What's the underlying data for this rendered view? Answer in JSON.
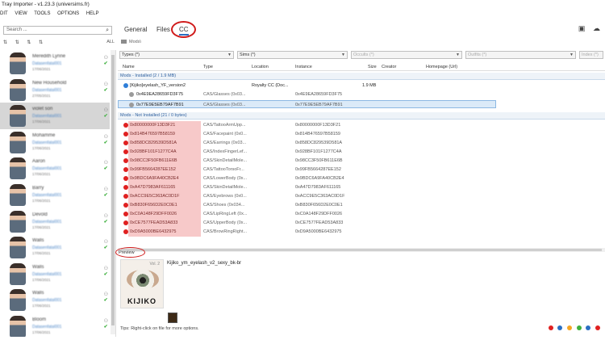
{
  "window": {
    "title": "Tray Importer - v1.23.3  (universims.fr)"
  },
  "menu": [
    "DIT",
    "VIEW",
    "TOOLS",
    "OPTIONS",
    "HELP"
  ],
  "search": {
    "placeholder": "Search ..."
  },
  "sidebar": {
    "tool_icons": [
      "sims-sort-icon",
      "households-sort-icon",
      "lots-sort-icon",
      "rooms-sort-icon"
    ],
    "all_label": "ALL",
    "households": [
      {
        "name": "Meredith Lynne",
        "sub": "Datasenfatal001",
        "date": "17/06/2021"
      },
      {
        "name": "New Household",
        "sub": "Datasenfatal001",
        "date": "27/05/2021"
      },
      {
        "name": "violet son",
        "sub": "Datasenfatal001",
        "date": "17/06/2021"
      },
      {
        "name": "Mohamme",
        "sub": "Datasenfatal001",
        "date": "17/06/2021"
      },
      {
        "name": "Aaron",
        "sub": "Datasenfatal001",
        "date": "17/06/2021"
      },
      {
        "name": "Barry",
        "sub": "Datasenfatal001",
        "date": "17/06/2021"
      },
      {
        "name": "Devold",
        "sub": "Datasenfatal001",
        "date": "17/06/2021"
      },
      {
        "name": "Walls",
        "sub": "Datasenfatal001",
        "date": "17/06/2021"
      },
      {
        "name": "Walls",
        "sub": "Datasenfatal001",
        "date": "17/06/2021"
      },
      {
        "name": "Walls",
        "sub": "Datasenfatal001",
        "date": "17/06/2021"
      },
      {
        "name": "Bloom",
        "sub": "Datasenfatal001",
        "date": "17/06/2021"
      }
    ]
  },
  "tabs": [
    {
      "label": "General"
    },
    {
      "label": "Files"
    },
    {
      "label": "CC"
    }
  ],
  "breadcrumb": "Mods\\",
  "filters": {
    "types": "Types (*)",
    "sims": "Sims (*)",
    "occults": "Occults (*)",
    "outfits": "Outfits (*)",
    "index": "Index (*)"
  },
  "columns": {
    "name": "Name",
    "type": "Type",
    "location": "Location",
    "instance": "Instance",
    "size": "Size",
    "creator": "Creator",
    "homepage": "Homepage (Url)"
  },
  "installed_group": "Mods - Installed  (2 / 1.9 MB)",
  "installed_rows": [
    {
      "name": "[Kijiko]eyelash_YF_version2",
      "type": "",
      "location": "Royalty CC (Doc...",
      "instance": "",
      "size": "1.9 MB",
      "dot": "#2f7ed8"
    },
    {
      "name": "0x4E9EA28659FD3F75",
      "type": "CAS/Glasses (0x03...",
      "location": "",
      "instance": "0x4E9EA28659FD3F75",
      "size": "",
      "dot": "#9a9a9a"
    },
    {
      "name": "0x77E9E5EB79AF7B91",
      "type": "CAS/Glasses (0x03...",
      "location": "",
      "instance": "0x77E9E5EB79AF7B91",
      "size": "",
      "dot": "#9a9a9a"
    }
  ],
  "notinstalled_group": "Mods - Not Installed  (21 / 0 bytes)",
  "notinstalled_rows": [
    {
      "name": "0x80000000F13D3F21",
      "type": "CAS/TattooArmUpp...",
      "instance": "0x80000000F13D3F21"
    },
    {
      "name": "0x814B476597B58159",
      "type": "CAS/Facepaint (0x0...",
      "instance": "0x814B476597B58159"
    },
    {
      "name": "0x858DC829539D581A",
      "type": "CAS/Earrings (0x03...",
      "instance": "0x858DC829539D581A"
    },
    {
      "name": "0x928BF101F1277C4A",
      "type": "CAS/IndexFingerLef...",
      "instance": "0x928BF101F1277C4A"
    },
    {
      "name": "0x98CC3F50FB611E6B",
      "type": "CAS/SkinDetailMole...",
      "instance": "0x98CC3F50FB611E6B"
    },
    {
      "name": "0x99FB5664287EE152",
      "type": "CAS/TattooTorsoFr...",
      "instance": "0x99FB5664287EE152"
    },
    {
      "name": "0x9BDC6A9FA40CB2E4",
      "type": "CAS/LowerBody (0x...",
      "instance": "0x9BDC6A9FA40CB2E4"
    },
    {
      "name": "0xA47D7983AF611165",
      "type": "CAS/SkinDetailMole...",
      "instance": "0xA47D7983AF611165"
    },
    {
      "name": "0xACC9E5C363AC0D1F",
      "type": "CAS/Eyebrows (0x0...",
      "instance": "0xACC9E5C363AC0D1F"
    },
    {
      "name": "0xB830F656D2E0C0E1",
      "type": "CAS/Shoes (0x034...",
      "instance": "0xB830F656D2E0C0E1"
    },
    {
      "name": "0xC0A148F29DFF0026",
      "type": "CAS/LipRingLeft (0x...",
      "instance": "0xC0A148F29DFF0026"
    },
    {
      "name": "0xCE7577FEAD53A833",
      "type": "CAS/UpperBody (0x...",
      "instance": "0xCE7577FEAD53A833"
    },
    {
      "name": "0xD9A5000BE6432975",
      "type": "CAS/BrowRingRight...",
      "instance": "0xD9A5000BE6432975"
    }
  ],
  "preview": {
    "label": "Preview",
    "title": "Kijiko_ym_eyelash_v2_sexy_bk-br",
    "brand": "KIJIKO",
    "badge": "Vol. 2"
  },
  "tips": "Tips:  Right-click on file for more options.",
  "status_colors": [
    "#e02020",
    "#2a6fc2",
    "#f5a623",
    "#3fb03f",
    "#2a6fc2",
    "#e02020"
  ]
}
